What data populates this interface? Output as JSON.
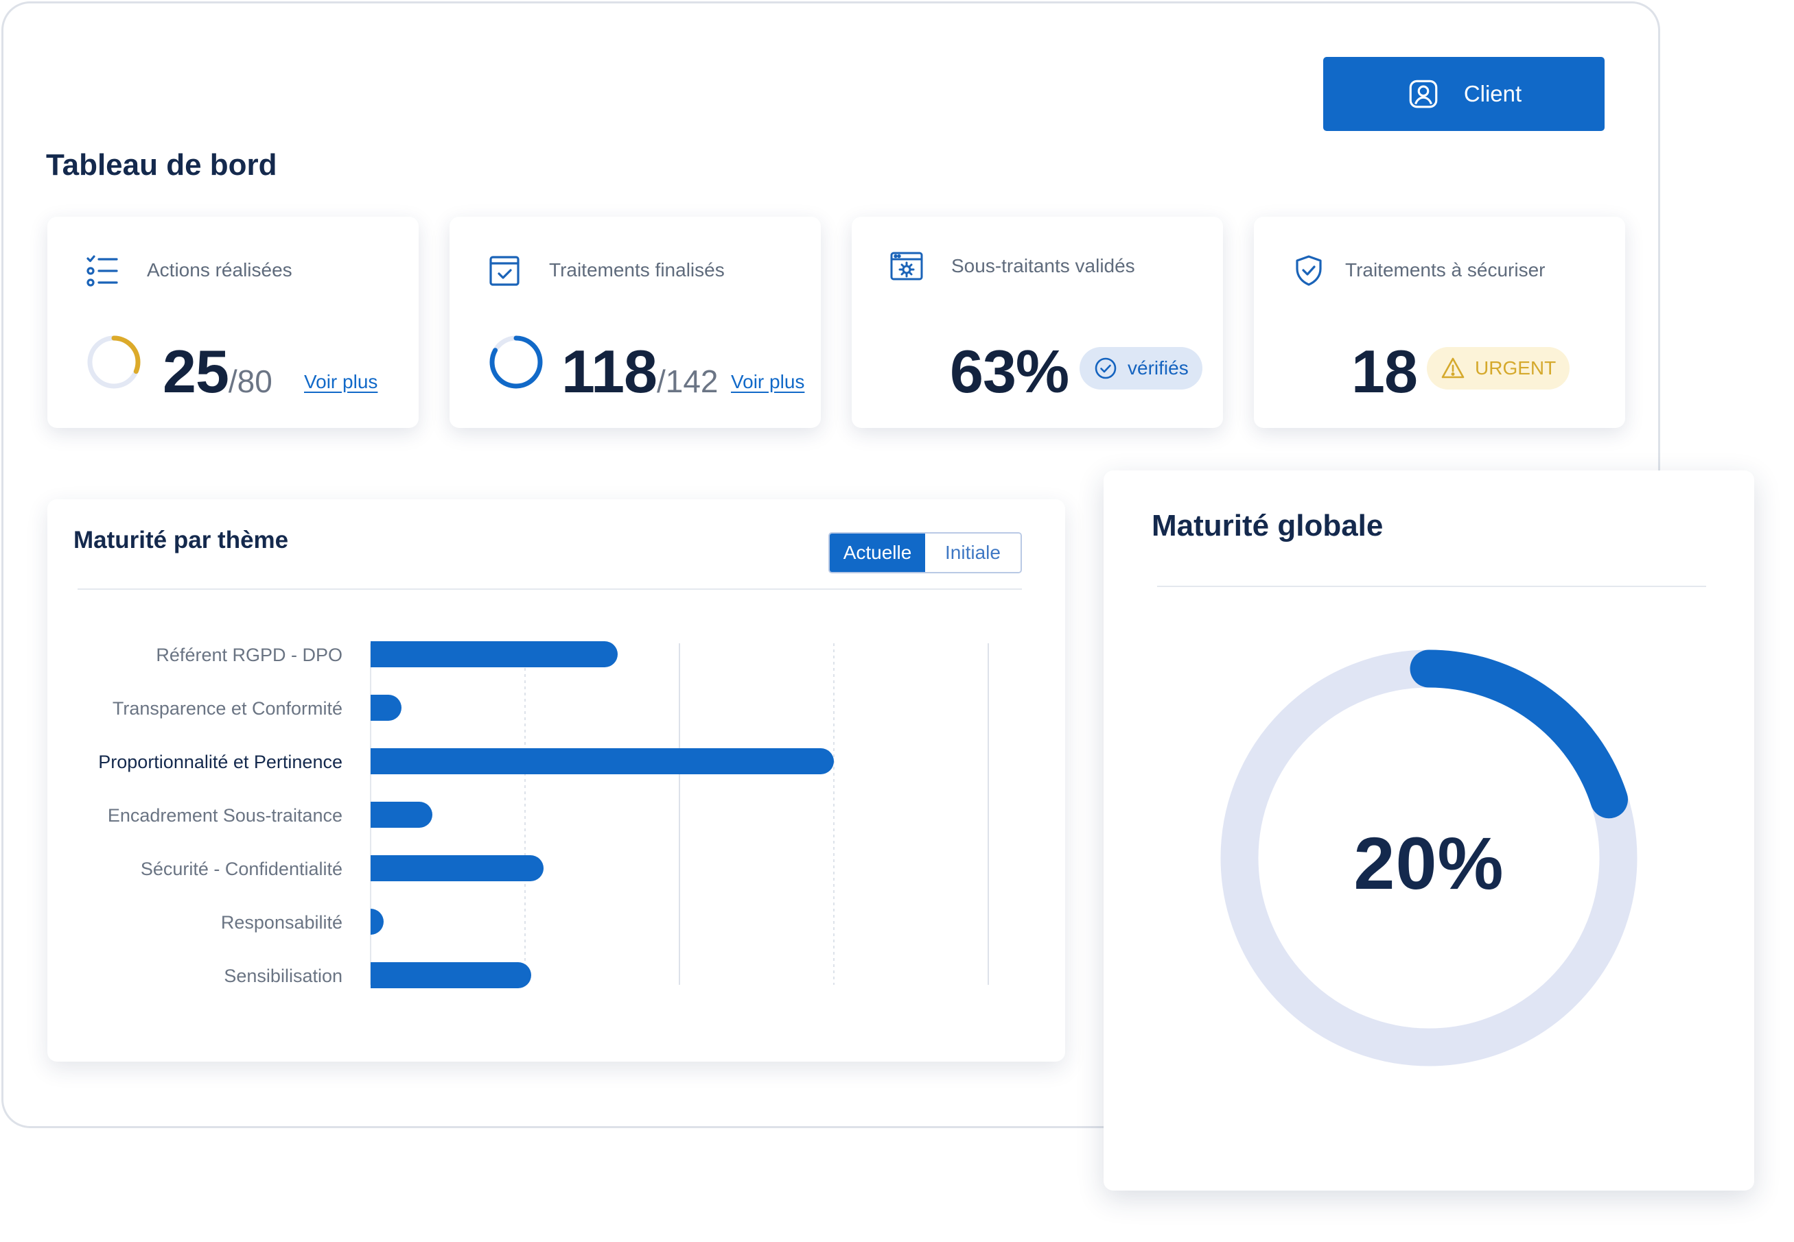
{
  "header": {
    "title": "Tableau de bord",
    "client_button": {
      "label": "Client",
      "icon": "user-portrait-icon"
    }
  },
  "stats": {
    "actions": {
      "label": "Actions réalisées",
      "icon": "checklist-icon",
      "value": "25",
      "total": "/80",
      "done": 25,
      "of": 80,
      "link": "Voir plus",
      "ring_color": "#dcaa2a"
    },
    "processing": {
      "label": "Traitements finalisés",
      "icon": "calendar-check-icon",
      "value": "118",
      "total": "/142",
      "done": 118,
      "of": 142,
      "link": "Voir plus",
      "ring_color": "#1169c8"
    },
    "subcontractors": {
      "label": "Sous-traitants validés",
      "icon": "browser-gear-icon",
      "value": "63%",
      "badge": "vérifiés",
      "badge_icon": "check-circle-icon"
    },
    "to_secure": {
      "label": "Traitements à sécuriser",
      "icon": "shield-check-icon",
      "value": "18",
      "badge": "URGENT",
      "badge_icon": "warning-triangle-icon"
    }
  },
  "theme_panel": {
    "title": "Maturité par thème",
    "toggle": {
      "active": "Actuelle",
      "inactive": "Initiale"
    }
  },
  "chart_data": {
    "type": "bar",
    "orientation": "horizontal",
    "categories": [
      "Référent RGPD - DPO",
      "Transparence et Conformité",
      "Proportionnalité et Pertinence",
      "Encadrement Sous-traitance",
      "Sécurité - Confidentialité",
      "Responsabilité",
      "Sensibilisation"
    ],
    "values": [
      40,
      5,
      75,
      10,
      28,
      2,
      26
    ],
    "highlighted_category": "Proportionnalité et Pertinence",
    "xlim": [
      0,
      100
    ],
    "grid": true,
    "bar_color": "#1169c8"
  },
  "global_panel": {
    "title": "Maturité globale",
    "value": "20%",
    "percent": 20,
    "ring_color": "#1169c8",
    "track_color": "#e0e5f4"
  }
}
